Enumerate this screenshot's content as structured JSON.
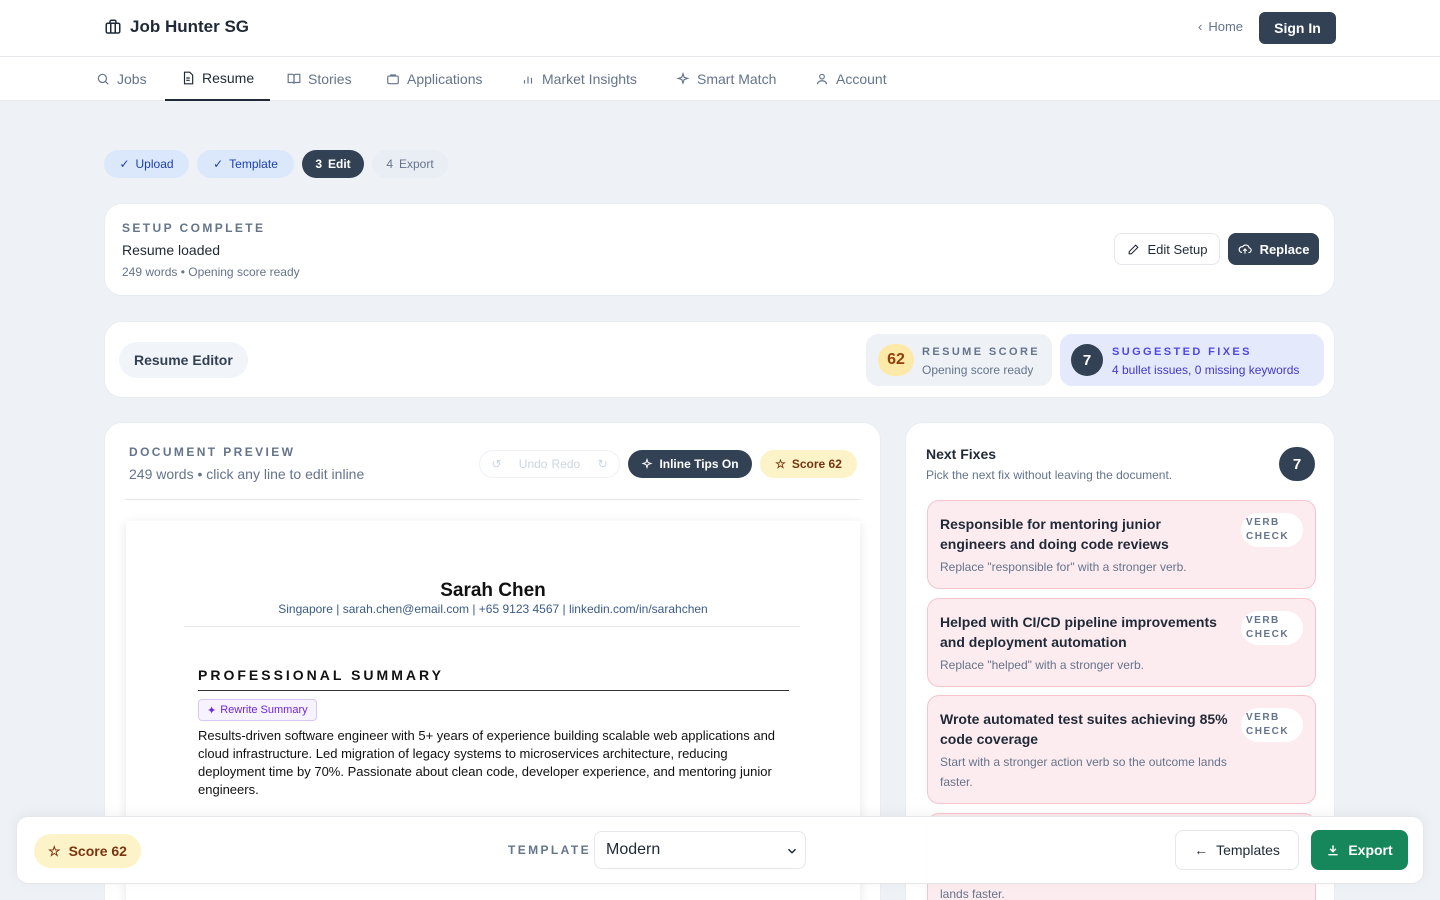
{
  "app": {
    "title": "Job Hunter SG"
  },
  "header": {
    "home_label": "Home",
    "signin_label": "Sign In"
  },
  "nav": {
    "items": [
      {
        "label": "Jobs"
      },
      {
        "label": "Resume"
      },
      {
        "label": "Stories"
      },
      {
        "label": "Applications"
      },
      {
        "label": "Market Insights"
      },
      {
        "label": "Smart Match"
      },
      {
        "label": "Account"
      }
    ],
    "active": "Resume"
  },
  "steps": [
    {
      "label": "Upload",
      "state": "done"
    },
    {
      "label": "Template",
      "state": "done"
    },
    {
      "num": "3",
      "label": "Edit",
      "state": "current"
    },
    {
      "num": "4",
      "label": "Export",
      "state": "todo"
    }
  ],
  "setup": {
    "eyebrow": "SETUP COMPLETE",
    "status": "Resume loaded",
    "meta": "249 words • Opening score ready",
    "edit_label": "Edit Setup",
    "replace_label": "Replace"
  },
  "editor": {
    "label": "Resume Editor",
    "score": {
      "value": "62",
      "eyebrow": "RESUME SCORE",
      "sub": "Opening score ready"
    },
    "fixes": {
      "value": "7",
      "eyebrow": "SUGGESTED FIXES",
      "sub": "4 bullet issues, 0 missing keywords"
    }
  },
  "preview": {
    "eyebrow": "DOCUMENT PREVIEW",
    "sub": "249 words • click any line to edit inline",
    "undo_label": "Undo",
    "redo_label": "Redo",
    "tips_label": "Inline Tips On",
    "score_label": "Score 62"
  },
  "resume": {
    "name": "Sarah Chen",
    "contact": "Singapore | sarah.chen@email.com | +65 9123 4567 | linkedin.com/in/sarahchen",
    "section_title": "PROFESSIONAL SUMMARY",
    "rewrite_label": "Rewrite Summary",
    "summary": "Results-driven software engineer with 5+ years of experience building scalable web applications and cloud infrastructure. Led migration of legacy systems to microservices architecture, reducing deployment time by 70%. Passionate about clean code, developer experience, and mentoring junior engineers."
  },
  "next_fixes": {
    "title": "Next Fixes",
    "desc": "Pick the next fix without leaving the document.",
    "count": "7",
    "items": [
      {
        "title": "Responsible for mentoring junior engineers and doing code reviews",
        "tag_line1": "VERB",
        "tag_line2": "CHECK",
        "desc": "Replace \"responsible for\" with a stronger verb."
      },
      {
        "title": "Helped with CI/CD pipeline improvements and deployment automation",
        "tag_line1": "VERB",
        "tag_line2": "CHECK",
        "desc": "Replace \"helped\" with a stronger verb."
      },
      {
        "title": "Wrote automated test suites achieving 85% code coverage",
        "tag_line1": "VERB",
        "tag_line2": "CHECK",
        "desc": "Start with a stronger action verb so the outcome lands faster."
      },
      {
        "desc_tail": "lands faster."
      }
    ]
  },
  "bottom": {
    "score_label": "Score 62",
    "template_label": "TEMPLATE",
    "template_value": "Modern",
    "templates_label": "Templates",
    "export_label": "Export"
  },
  "colors": {
    "primary": "#334155",
    "export": "#16875a",
    "score_bg": "#fdf3c9",
    "fix_bg": "#fdecef"
  }
}
